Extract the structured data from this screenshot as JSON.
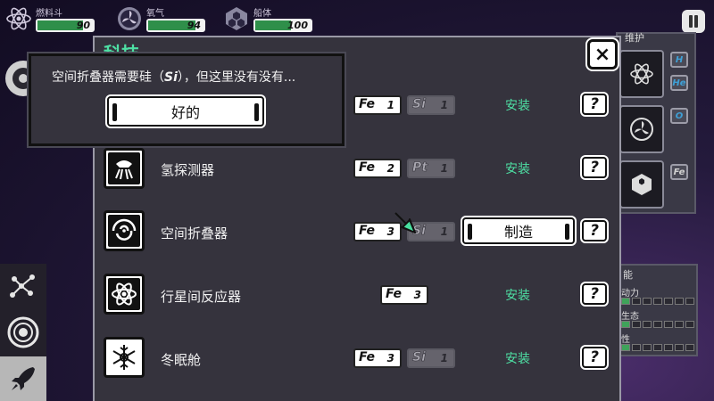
{
  "status": {
    "fuel": {
      "label": "燃料斗",
      "value": "90",
      "level_pct": 90,
      "icon": "atom-icon"
    },
    "oxygen": {
      "label": "氧气",
      "value": "94",
      "level_pct": 94,
      "icon": "fan-icon"
    },
    "hull": {
      "label": "船体",
      "value": "100",
      "level_pct": 100,
      "icon": "hexagon-icon"
    }
  },
  "main": {
    "title": "科技",
    "close_label": "×",
    "install_label": "安装",
    "build_label": "制造",
    "help_label": "?",
    "rows": [
      {
        "name": "",
        "icon": "module-icon",
        "materials": [
          {
            "sym": "Fe",
            "qty": "1",
            "available": true
          },
          {
            "sym": "Si",
            "qty": "1",
            "available": false
          }
        ],
        "action": "安装"
      },
      {
        "name": "氢探测器",
        "icon": "hydrogen-probe-icon",
        "materials": [
          {
            "sym": "Fe",
            "qty": "2",
            "available": true
          },
          {
            "sym": "Pt",
            "qty": "1",
            "available": false
          }
        ],
        "action": "安装"
      },
      {
        "name": "空间折叠器",
        "icon": "space-fold-icon",
        "materials": [
          {
            "sym": "Fe",
            "qty": "3",
            "available": true
          },
          {
            "sym": "Si",
            "qty": "1",
            "available": false
          }
        ],
        "action": "制造"
      },
      {
        "name": "行星间反应器",
        "icon": "reactor-icon",
        "materials": [
          {
            "sym": "Fe",
            "qty": "3",
            "available": true
          }
        ],
        "action": "安装"
      },
      {
        "name": "冬眠舱",
        "icon": "snowflake-icon",
        "materials": [
          {
            "sym": "Fe",
            "qty": "3",
            "available": true
          },
          {
            "sym": "Si",
            "qty": "1",
            "available": false
          }
        ],
        "action": "安装"
      }
    ]
  },
  "dialog": {
    "message_pre": "空间折叠器需要硅（",
    "message_si": "Si",
    "message_post": "），但这里没有没有...",
    "ok_label": "好的"
  },
  "right_panel": {
    "title": "维护",
    "chips": [
      "H",
      "He",
      "O",
      "Fe"
    ]
  },
  "right_panel2": {
    "title": "能",
    "rows": [
      "动力",
      "生态",
      "性"
    ],
    "levels": [
      1,
      1,
      1
    ]
  },
  "colors": {
    "accent": "#4ee0a4",
    "panel": "#35333d",
    "bar_fill": "#2f8f4a"
  }
}
